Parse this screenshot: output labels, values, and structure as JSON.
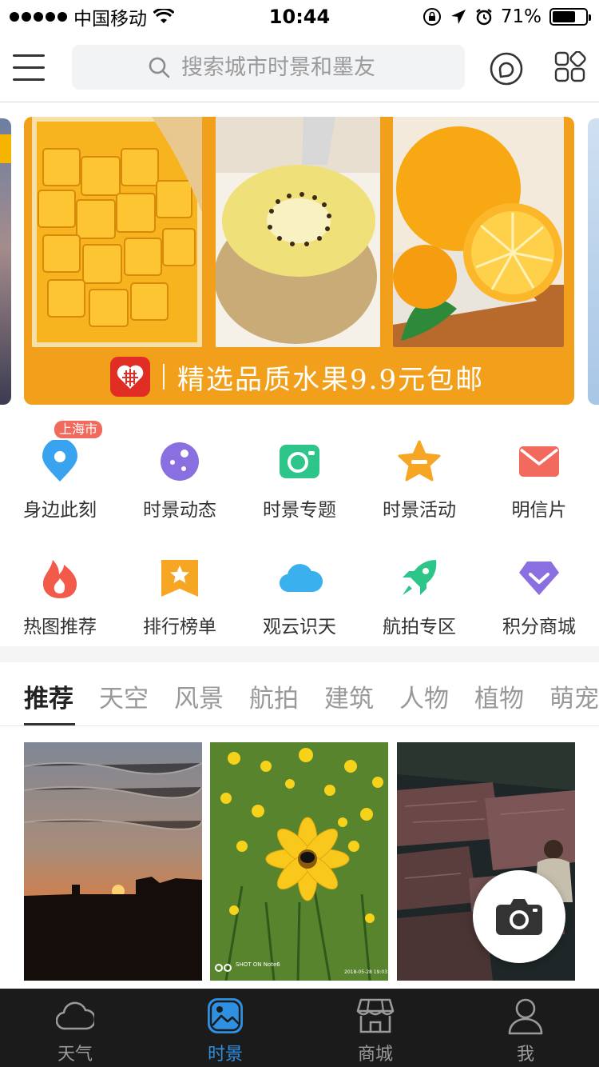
{
  "status_bar": {
    "carrier": "中国移动",
    "time": "10:44",
    "battery_percent_label": "71%",
    "battery_level": 0.71
  },
  "header": {
    "search_placeholder": "搜索城市时景和墨友",
    "menu_icon": "hamburger-menu-icon",
    "chat_icon": "chat-bubble-icon",
    "apps_icon": "grid-apps-icon"
  },
  "banner": {
    "caption": "精选品质水果9.9元包邮",
    "accent_color": "#f2a01b"
  },
  "quick_entries": {
    "location_badge": "上海市",
    "items": [
      {
        "label": "身边此刻",
        "icon": "location-pin-icon",
        "color": "#3aa3f0"
      },
      {
        "label": "时景动态",
        "icon": "planet-icon",
        "color": "#8a6fe0"
      },
      {
        "label": "时景专题",
        "icon": "camera-card-icon",
        "color": "#2ec58a"
      },
      {
        "label": "时景活动",
        "icon": "star-badge-icon",
        "color": "#f6a623"
      },
      {
        "label": "明信片",
        "icon": "envelope-icon",
        "color": "#f26a5e"
      },
      {
        "label": "热图推荐",
        "icon": "flame-icon",
        "color": "#f25a4a"
      },
      {
        "label": "排行榜单",
        "icon": "ranking-star-icon",
        "color": "#f6a623"
      },
      {
        "label": "观云识天",
        "icon": "cloud-icon",
        "color": "#3ab0ee"
      },
      {
        "label": "航拍专区",
        "icon": "rocket-icon",
        "color": "#2ec58a"
      },
      {
        "label": "积分商城",
        "icon": "diamond-icon",
        "color": "#8a6fe0"
      }
    ]
  },
  "category_tabs": [
    "推荐",
    "天空",
    "风景",
    "航拍",
    "建筑",
    "人物",
    "植物",
    "萌宠"
  ],
  "photos": [
    {
      "subject": "sunset"
    },
    {
      "subject": "yellow-flower",
      "watermark_left": "SHOT ON Note6",
      "watermark_right": "2018-05-28 19:03"
    },
    {
      "subject": "rock-wall"
    }
  ],
  "tab_bar": {
    "items": [
      {
        "label": "天气",
        "icon": "cloud-outline-icon"
      },
      {
        "label": "时景",
        "icon": "photo-icon"
      },
      {
        "label": "商城",
        "icon": "shop-icon"
      },
      {
        "label": "我",
        "icon": "user-icon"
      }
    ],
    "active_color": "#2f8fe0"
  }
}
